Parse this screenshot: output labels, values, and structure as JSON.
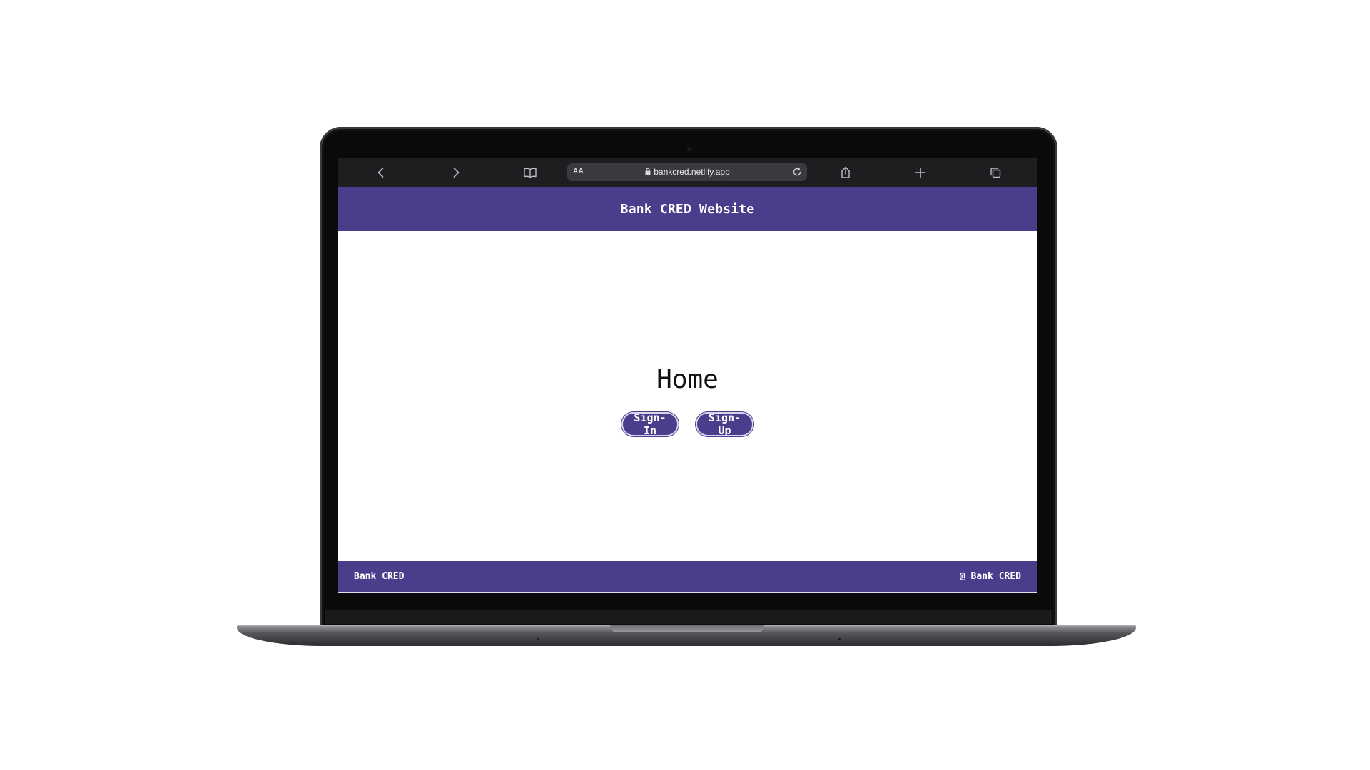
{
  "browser": {
    "text_size_label": "AA",
    "url": "bankcred.netlify.app",
    "icons": [
      "chevron-left-icon",
      "chevron-right-icon",
      "book-icon",
      "lock-icon",
      "reload-icon",
      "share-icon",
      "plus-icon",
      "tabs-icon"
    ]
  },
  "header": {
    "title": "Bank CRED Website"
  },
  "main": {
    "heading": "Home",
    "buttons": {
      "sign_in": "Sign-In",
      "sign_up": "Sign-Up"
    }
  },
  "footer": {
    "left": "Bank CRED",
    "right": "@ Bank CRED"
  },
  "colors": {
    "brand": "#4a3d8c",
    "toolbar": "#1e1e21",
    "page_background": "#ffffff"
  }
}
